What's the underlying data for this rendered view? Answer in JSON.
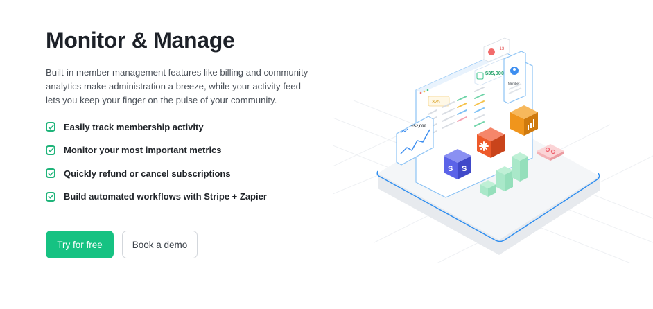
{
  "hero": {
    "title": "Monitor & Manage",
    "description": "Built-in member management features like billing and community analytics make administration a breeze, while your activity feed lets you keep your finger on the pulse of your community."
  },
  "features": [
    {
      "label": "Easily track membership activity",
      "icon": "check-square-icon"
    },
    {
      "label": "Monitor your most important metrics",
      "icon": "check-square-icon"
    },
    {
      "label": "Quickly refund or cancel subscriptions",
      "icon": "check-square-icon"
    },
    {
      "label": "Build automated workflows with Stripe + Zapier",
      "icon": "check-square-icon"
    }
  ],
  "actions": {
    "primary_label": "Try for free",
    "secondary_label": "Book a demo"
  },
  "illustration": {
    "notification_badge": "+13",
    "revenue_badge": "$35,000",
    "small_value": "325",
    "chart_badge": "+$2,000",
    "member_label": "Member",
    "stripe_letter": "S"
  },
  "colors": {
    "accent_green": "#16c282",
    "check_green": "#1fb47a",
    "cube_blue": "#5b63e8",
    "cube_red": "#ee5a2a",
    "cube_orange": "#f0951c",
    "platform_outline": "#2f8ef0"
  }
}
